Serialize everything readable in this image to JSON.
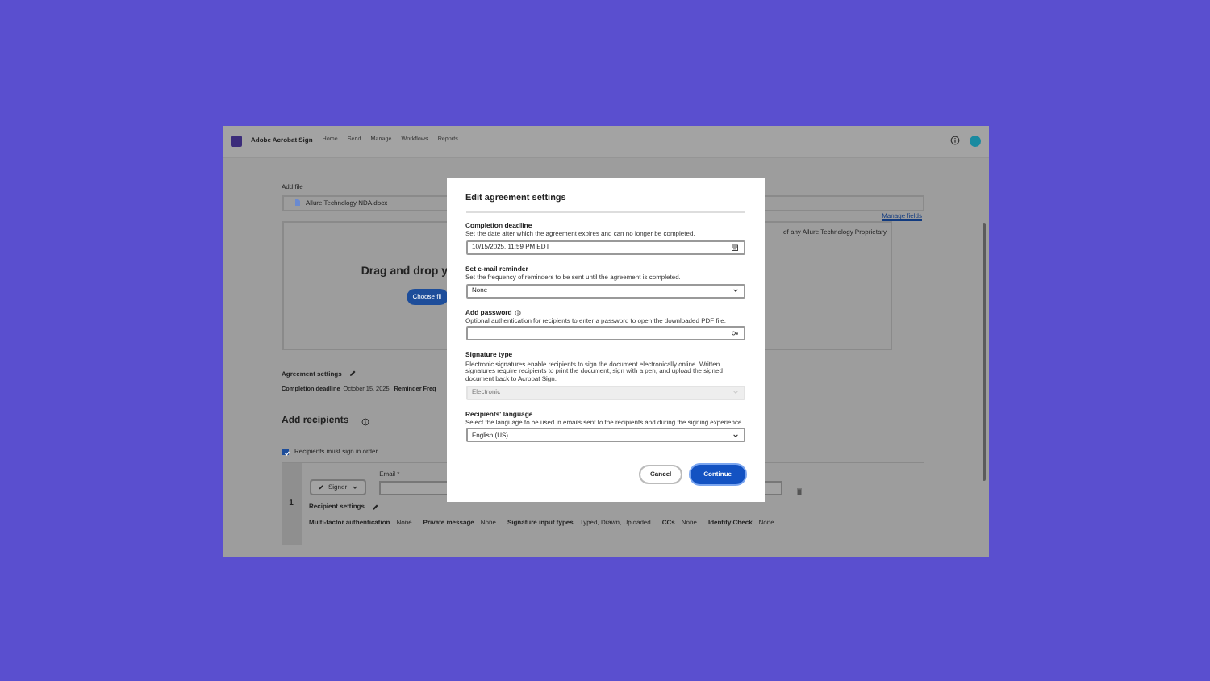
{
  "app": {
    "name": "Adobe Acrobat Sign",
    "nav": [
      {
        "label": "Home"
      },
      {
        "label": "Send"
      },
      {
        "label": "Manage"
      },
      {
        "label": "Workflows"
      },
      {
        "label": "Reports"
      }
    ]
  },
  "background": {
    "file_label": "Add file",
    "file_name": "Allure Technology NDA.docx",
    "manage_fields": "Manage fields",
    "drop_text": "Drag and drop y",
    "choose_button": "Choose fil",
    "note": "of any Allure Technology Proprietary",
    "settings_title": "Agreement settings",
    "deadline_label": "Completion deadline",
    "deadline_value": "October 15, 2025",
    "reminder_label": "Reminder Freq",
    "recipients_title": "Add recipients",
    "sign_in_order": {
      "label": "Recipients must sign in order",
      "checked": true
    },
    "recipient": {
      "number": "1",
      "role": "Signer",
      "email_label": "Email *",
      "settings_title": "Recipient settings",
      "details": [
        {
          "label": "Multi-factor authentication",
          "value": "None"
        },
        {
          "label": "Private message",
          "value": "None"
        },
        {
          "label": "Signature input types",
          "value": "Typed, Drawn, Uploaded"
        },
        {
          "label": "CCs",
          "value": "None"
        },
        {
          "label": "Identity Check",
          "value": "None"
        }
      ]
    }
  },
  "dialog": {
    "title": "Edit agreement settings",
    "fields": [
      {
        "kind": "date",
        "label": "Completion deadline",
        "description": "Set the date after which the agreement expires and can no longer be completed.",
        "value": "10/15/2025, 11:59 PM EDT",
        "disabled": false,
        "info": false
      },
      {
        "kind": "select",
        "label": "Set e-mail reminder",
        "description": "Set the frequency of reminders to be sent until the agreement is completed.",
        "value": "None",
        "disabled": false,
        "info": false
      },
      {
        "kind": "password",
        "label": "Add password",
        "description": "Optional authentication for recipients to enter a password to open the downloaded PDF file.",
        "disabled": false,
        "info": true
      },
      {
        "kind": "select",
        "label": "Signature type",
        "description": "Electronic signatures enable recipients to sign the document electronically online. Written signatures require recipients to print the document, sign with a pen, and upload the signed document back to Acrobat Sign.",
        "value": "Electronic",
        "disabled": true,
        "info": false
      },
      {
        "kind": "select",
        "label": "Recipients' language",
        "description": "Select the language to be used in emails sent to the recipients and during the signing experience.",
        "value": "English (US)",
        "disabled": false,
        "info": false
      }
    ],
    "buttons": [
      {
        "label": "Cancel",
        "kind": "secondary"
      },
      {
        "label": "Continue",
        "kind": "primary"
      }
    ]
  }
}
